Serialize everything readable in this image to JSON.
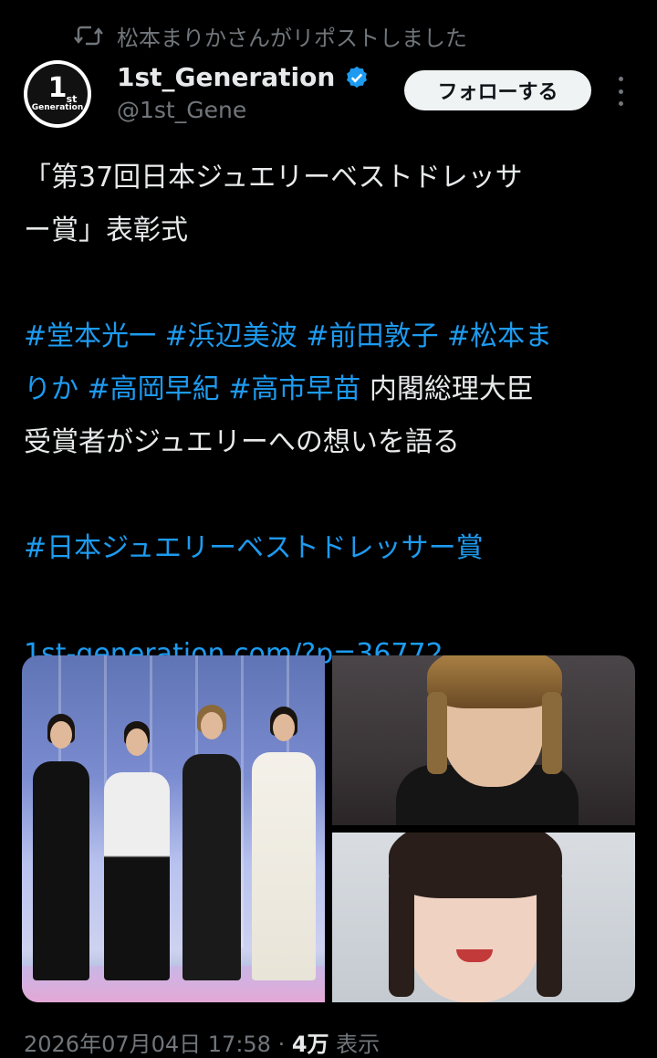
{
  "repost": {
    "label": "松本まりかさんがリポストしました"
  },
  "author": {
    "avatar_number": "1",
    "avatar_suffix": "st",
    "avatar_subtext": "Generation",
    "name": "1st_Generation",
    "handle": "@1st_Gene",
    "verified": true
  },
  "follow_button": "フォローする",
  "post": {
    "title_line1": "「第37回日本ジュエリーベストドレッサ",
    "title_line2": "ー賞」表彰式",
    "tags_line1": "#堂本光一 #浜辺美波 #前田敦子 #松本ま",
    "tags_line2a": "りか #高岡早紀  #高市早苗",
    "tags_line2b": " 内閣総理大臣",
    "text_line3": "受賞者がジュエリーへの想いを語る",
    "hashtag_award": "#日本ジュエリーベストドレッサー賞",
    "link": "1st-generation.com/?p=36772"
  },
  "media": [
    {
      "name": "award-ceremony-photo"
    },
    {
      "name": "man-portrait-photo"
    },
    {
      "name": "woman-portrait-photo"
    }
  ],
  "meta": {
    "date": "2026年07月04日 17:58",
    "separator": " · ",
    "views": "4万",
    "views_label": " 表示"
  },
  "colors": {
    "accent": "#1d9bf0",
    "background": "#000000",
    "muted": "#71767b",
    "text": "#e7e9ea"
  }
}
